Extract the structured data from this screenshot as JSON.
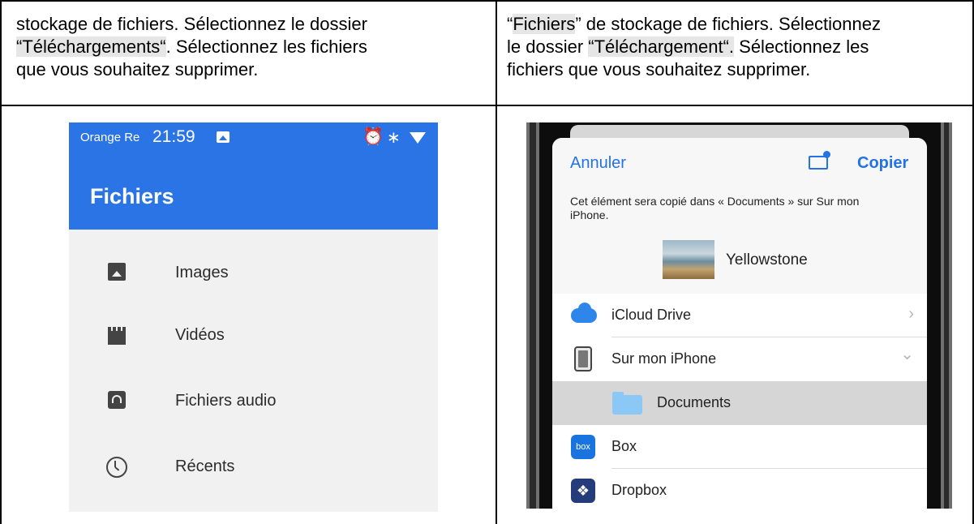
{
  "left_cell": {
    "text_line1": "stockage de fichiers. Sélectionnez le dossier",
    "text_line2_hl": "“Téléchargements“",
    "text_line2_rest": ". Sélectionnez les fichiers",
    "text_line3": "que vous souhaitez supprimer."
  },
  "right_cell": {
    "text_line1_q1": "“",
    "text_line1_hl": "Fichiers",
    "text_line1_rest": "” de stockage de fichiers. Sélectionnez",
    "text_line2_pre": "le dossier ",
    "text_line2_hl": "“Téléchargement“.",
    "text_line2_rest": " Sélectionnez les",
    "text_line3": "fichiers que vous souhaitez supprimer."
  },
  "android": {
    "carrier": "Orange Re",
    "time": "21:59",
    "alarm_icon": "⏰",
    "bluetooth_icon": "∗",
    "title": "Fichiers",
    "items": [
      {
        "label": "Images",
        "icon": "image-icon"
      },
      {
        "label": "Vidéos",
        "icon": "video-icon"
      },
      {
        "label": "Fichiers audio",
        "icon": "audio-icon"
      },
      {
        "label": "Récents",
        "icon": "clock-icon"
      }
    ]
  },
  "ios": {
    "cancel": "Annuler",
    "copy": "Copier",
    "message": "Cet élément sera copié dans « Documents » sur Sur mon iPhone.",
    "file_name": "Yellowstone",
    "locations": [
      {
        "label": "iCloud Drive",
        "chevron": "›"
      },
      {
        "label": "Sur mon iPhone",
        "chevron": "⌄"
      },
      {
        "label": "Documents"
      },
      {
        "label": "Box",
        "badge": "box"
      },
      {
        "label": "Dropbox",
        "badge": "❖"
      }
    ],
    "accent_color": "#2472e8"
  },
  "colors": {
    "android_blue": "#2a74e5",
    "highlight": "#e6e6e6"
  }
}
